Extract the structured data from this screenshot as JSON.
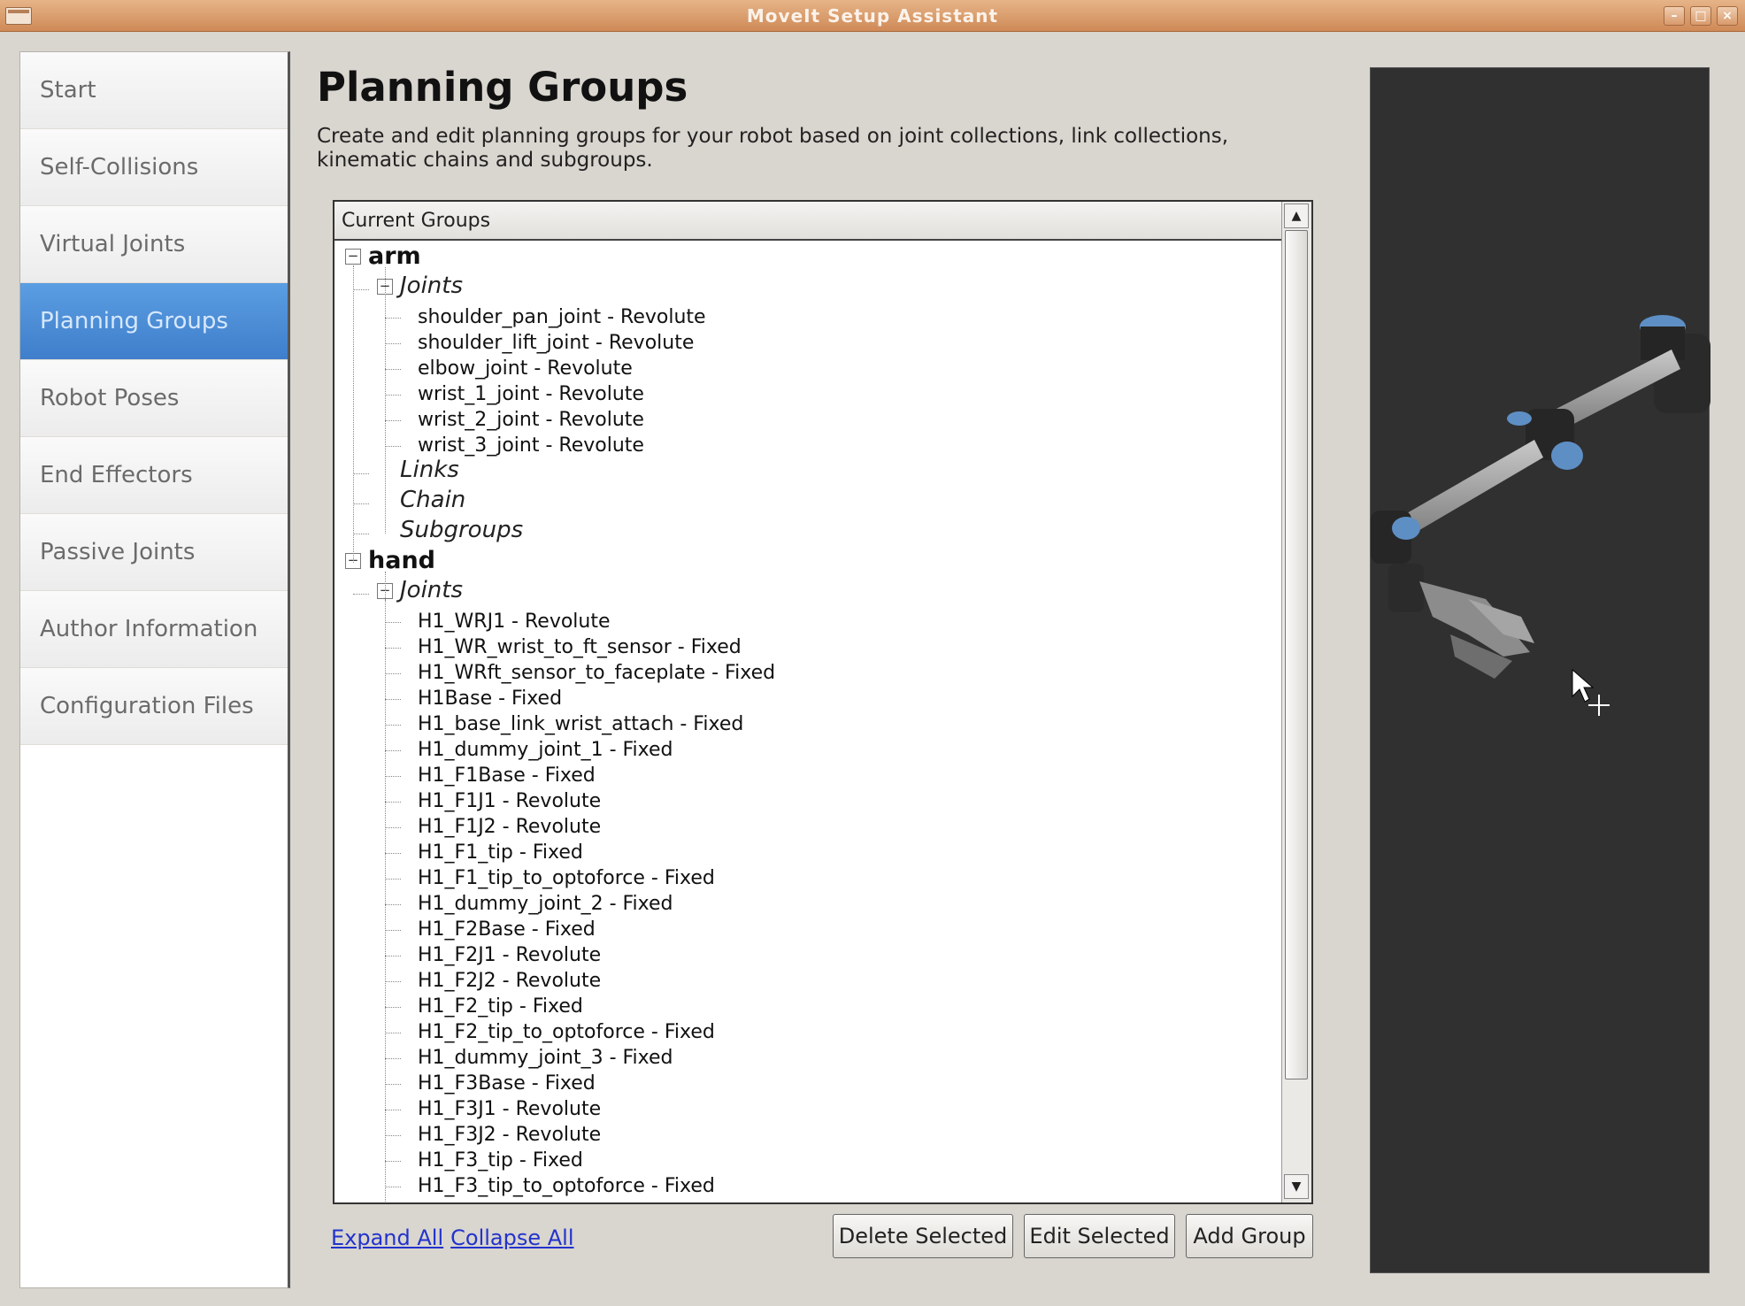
{
  "window": {
    "title": "MoveIt Setup Assistant"
  },
  "sidebar": {
    "items": [
      {
        "label": "Start",
        "active": false
      },
      {
        "label": "Self-Collisions",
        "active": false
      },
      {
        "label": "Virtual Joints",
        "active": false
      },
      {
        "label": "Planning Groups",
        "active": true
      },
      {
        "label": "Robot Poses",
        "active": false
      },
      {
        "label": "End Effectors",
        "active": false
      },
      {
        "label": "Passive Joints",
        "active": false
      },
      {
        "label": "Author Information",
        "active": false
      },
      {
        "label": "Configuration Files",
        "active": false
      }
    ]
  },
  "main": {
    "title": "Planning Groups",
    "description": "Create and edit planning groups for your robot based on joint collections, link collections, kinematic chains and subgroups."
  },
  "tree": {
    "header": "Current Groups",
    "rows": [
      {
        "type": "group",
        "level": 0,
        "text": "arm",
        "toggle": "⊟"
      },
      {
        "type": "cat",
        "level": 1,
        "text": "Joints",
        "toggle": "⊟"
      },
      {
        "type": "leaf",
        "level": 2,
        "text": "shoulder_pan_joint - Revolute"
      },
      {
        "type": "leaf",
        "level": 2,
        "text": "shoulder_lift_joint - Revolute"
      },
      {
        "type": "leaf",
        "level": 2,
        "text": "elbow_joint - Revolute"
      },
      {
        "type": "leaf",
        "level": 2,
        "text": "wrist_1_joint - Revolute"
      },
      {
        "type": "leaf",
        "level": 2,
        "text": "wrist_2_joint - Revolute"
      },
      {
        "type": "leaf",
        "level": 2,
        "text": "wrist_3_joint - Revolute"
      },
      {
        "type": "cat",
        "level": 1,
        "text": "Links"
      },
      {
        "type": "cat",
        "level": 1,
        "text": "Chain"
      },
      {
        "type": "cat",
        "level": 1,
        "text": "Subgroups"
      },
      {
        "type": "group",
        "level": 0,
        "text": "hand",
        "toggle": "⊟"
      },
      {
        "type": "cat",
        "level": 1,
        "text": "Joints",
        "toggle": "⊟"
      },
      {
        "type": "leaf",
        "level": 2,
        "text": "H1_WRJ1 - Revolute"
      },
      {
        "type": "leaf",
        "level": 2,
        "text": "H1_WR_wrist_to_ft_sensor - Fixed"
      },
      {
        "type": "leaf",
        "level": 2,
        "text": "H1_WRft_sensor_to_faceplate - Fixed"
      },
      {
        "type": "leaf",
        "level": 2,
        "text": "H1Base - Fixed"
      },
      {
        "type": "leaf",
        "level": 2,
        "text": "H1_base_link_wrist_attach - Fixed"
      },
      {
        "type": "leaf",
        "level": 2,
        "text": "H1_dummy_joint_1 - Fixed"
      },
      {
        "type": "leaf",
        "level": 2,
        "text": "H1_F1Base - Fixed"
      },
      {
        "type": "leaf",
        "level": 2,
        "text": "H1_F1J1 - Revolute"
      },
      {
        "type": "leaf",
        "level": 2,
        "text": "H1_F1J2 - Revolute"
      },
      {
        "type": "leaf",
        "level": 2,
        "text": "H1_F1_tip - Fixed"
      },
      {
        "type": "leaf",
        "level": 2,
        "text": "H1_F1_tip_to_optoforce - Fixed"
      },
      {
        "type": "leaf",
        "level": 2,
        "text": "H1_dummy_joint_2 - Fixed"
      },
      {
        "type": "leaf",
        "level": 2,
        "text": "H1_F2Base - Fixed"
      },
      {
        "type": "leaf",
        "level": 2,
        "text": "H1_F2J1 - Revolute"
      },
      {
        "type": "leaf",
        "level": 2,
        "text": "H1_F2J2 - Revolute"
      },
      {
        "type": "leaf",
        "level": 2,
        "text": "H1_F2_tip - Fixed"
      },
      {
        "type": "leaf",
        "level": 2,
        "text": "H1_F2_tip_to_optoforce - Fixed"
      },
      {
        "type": "leaf",
        "level": 2,
        "text": "H1_dummy_joint_3 - Fixed"
      },
      {
        "type": "leaf",
        "level": 2,
        "text": "H1_F3Base - Fixed"
      },
      {
        "type": "leaf",
        "level": 2,
        "text": "H1_F3J1 - Revolute"
      },
      {
        "type": "leaf",
        "level": 2,
        "text": "H1_F3J2 - Revolute"
      },
      {
        "type": "leaf",
        "level": 2,
        "text": "H1_F3_tip - Fixed"
      },
      {
        "type": "leaf",
        "level": 2,
        "text": "H1_F3_tip_to_optoforce - Fixed"
      }
    ]
  },
  "links": {
    "expand_all": "Expand All",
    "collapse_all": "Collapse All"
  },
  "buttons": {
    "delete": "Delete Selected",
    "edit": "Edit Selected",
    "add": "Add Group"
  },
  "colors": {
    "accent": "#4a8ad6",
    "titlebar": "#d9955f",
    "viewport_bg": "#303030",
    "robot_joint": "#5e8fc4"
  },
  "icons": {
    "collapse": "minus-box-icon",
    "scroll_up": "arrow-up-icon",
    "scroll_down": "arrow-down-icon"
  }
}
